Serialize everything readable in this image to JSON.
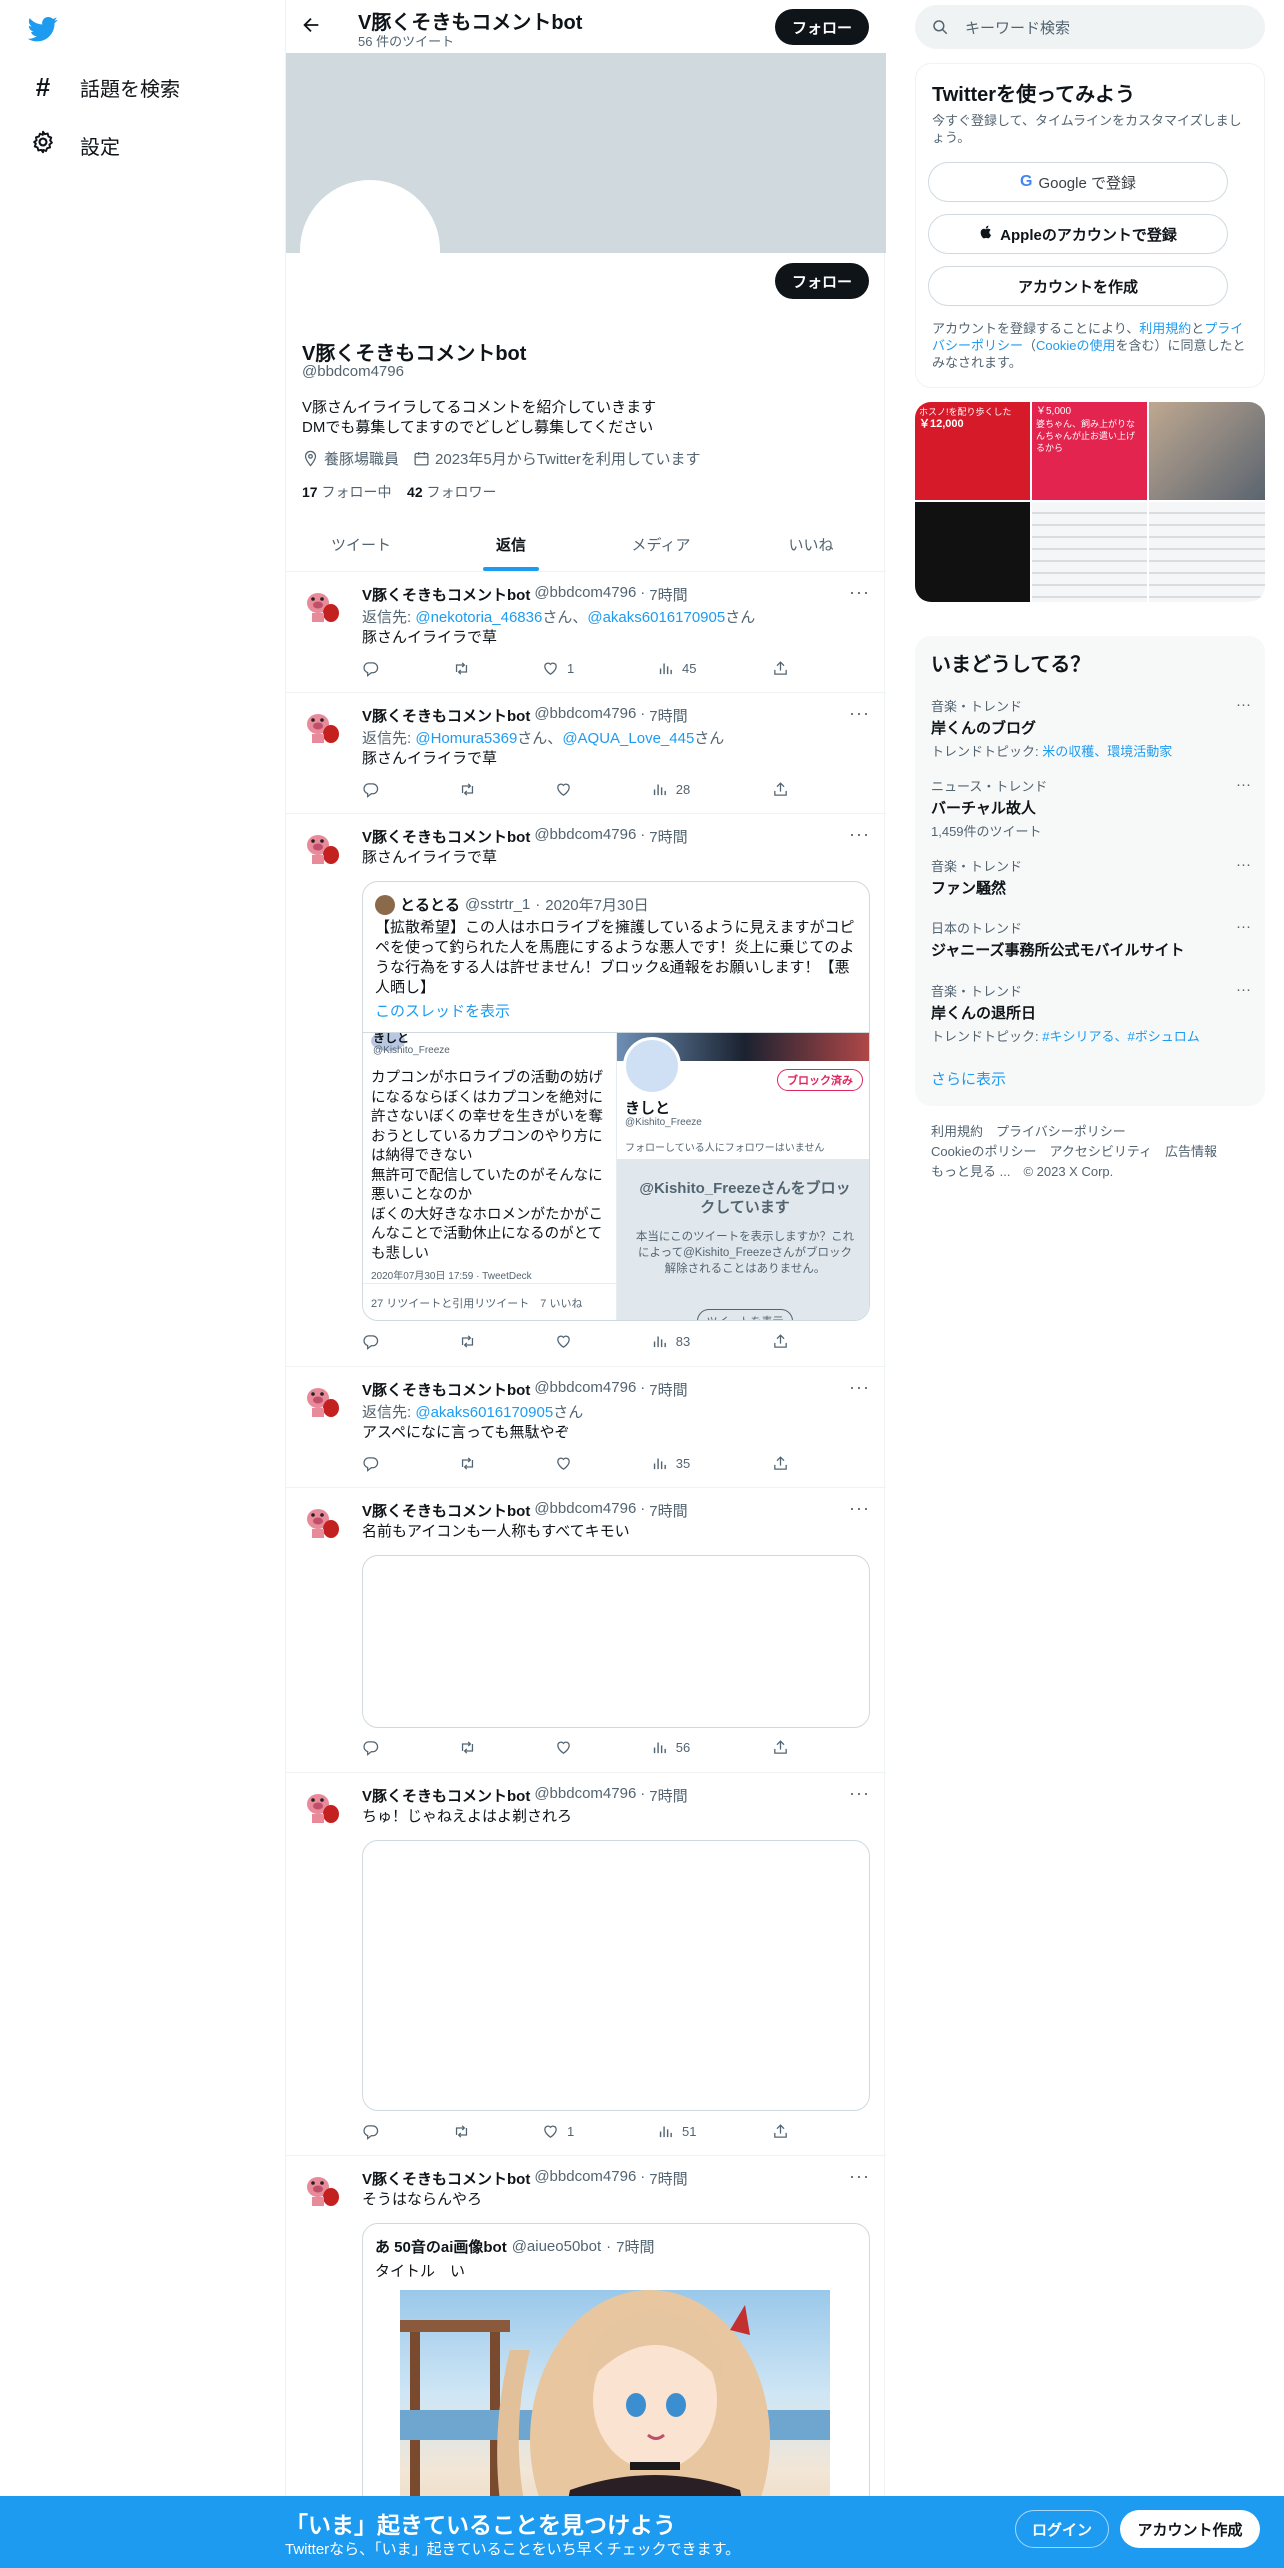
{
  "nav": {
    "explore": "話題を検索",
    "settings": "設定"
  },
  "topbar": {
    "name": "V豚くそきもコメントbot",
    "count": "56 件のツイート",
    "follow": "フォロー"
  },
  "profile": {
    "follow_button": "フォロー",
    "name": "V豚くそきもコメントbot",
    "handle": "@bbdcom4796",
    "bio_line1": "V豚さんイライラしてるコメントを紹介していきます",
    "bio_line2": "DMでも募集してますのでどしどし募集してください",
    "location": "養豚場職員",
    "joined": "2023年5月からTwitterを利用しています",
    "following_count": "17",
    "following_label": "フォロー中",
    "followers_count": "42",
    "followers_label": "フォロワー"
  },
  "tabs": [
    "ツイート",
    "返信",
    "メディア",
    "いいね"
  ],
  "tweets": [
    {
      "name": "V豚くそきもコメントbot",
      "handle": "@bbdcom4796",
      "time": "7時間",
      "reply_prefix": "返信先: ",
      "reply_to": "@nekotoria_46836",
      "reply_mid": "さん、",
      "reply_to2": "@akaks6016170905",
      "reply_suffix": "さん",
      "text": "豚さんイライラで草",
      "likes": "1",
      "views": "45"
    },
    {
      "name": "V豚くそきもコメントbot",
      "handle": "@bbdcom4796",
      "time": "7時間",
      "reply_prefix": "返信先: ",
      "reply_to": "@Homura5369",
      "reply_mid": "さん、",
      "reply_to2": "@AQUA_Love_445",
      "reply_suffix": "さん",
      "text": "豚さんイライラで草",
      "likes": "",
      "views": "28"
    },
    {
      "name": "V豚くそきもコメントbot",
      "handle": "@bbdcom4796",
      "time": "7時間",
      "text": "豚さんイライラで草",
      "views": "83",
      "quote": {
        "name": "とるとる",
        "handle": "@sstrtr_1",
        "date": "2020年7月30日",
        "text": "【拡散希望】この人はホロライブを擁護しているように見えますがコピペを使って釣られた人を馬鹿にするような悪人です！炎上に乗じてのような行為をする人は許せません！ブロック&通報をお願いします！【悪人晒し】",
        "thread": "このスレッドを表示",
        "inner_left": {
          "name": "きしと",
          "handle": "@Kishito_Freeze",
          "text": "カプコンがホロライブの活動の妨げになるならぼくはカプコンを絶対に許さないぼくの幸せを生きがいを奪おうとしているカプコンのやり方には納得できない\n無許可で配信していたのがそんなに悪いことなのか\nぼくの大好きなホロメンがたかがこんなことで活動休止になるのがとても悲しい",
          "meta": "2020年07月30日 17:59 · TweetDeck",
          "stats": "27 リツイートと引用リツイート　7 いいね"
        },
        "inner_right": {
          "name": "きしと",
          "handle": "@Kishito_Freeze",
          "blocked": "ブロック済み",
          "no_followers": "フォローしている人にフォロワーはいません",
          "block_title": "@Kishito_Freezeさんをブロックしています",
          "block_text": "本当にこのツイートを表示しますか？これによって@Kishito_Freezeさんがブロック解除されることはありません。",
          "show": "ツイートを表示"
        }
      }
    },
    {
      "name": "V豚くそきもコメントbot",
      "handle": "@bbdcom4796",
      "time": "7時間",
      "reply_prefix": "返信先: ",
      "reply_to": "@akaks6016170905",
      "reply_suffix": "さん",
      "text": "アスペになに言っても無駄やぞ",
      "views": "35"
    },
    {
      "name": "V豚くそきもコメントbot",
      "handle": "@bbdcom4796",
      "time": "7時間",
      "text": "名前もアイコンも一人称もすべてキモい",
      "views": "56"
    },
    {
      "name": "V豚くそきもコメントbot",
      "handle": "@bbdcom4796",
      "time": "7時間",
      "text": "ちゅ！じゃねえよはよ剃されろ",
      "likes": "1",
      "views": "51"
    },
    {
      "name": "V豚くそきもコメントbot",
      "handle": "@bbdcom4796",
      "time": "7時間",
      "text": "そうはならんやろ",
      "quote": {
        "name": "あ 50音のai画像bot",
        "handle": "@aiueo50bot",
        "time": "7時間",
        "text": "タイトル　い"
      }
    }
  ],
  "search": {
    "placeholder": "キーワード検索"
  },
  "signup": {
    "title": "Twitterを使ってみよう",
    "subtitle": "今すぐ登録して、タイムラインをカスタマイズしましょう。",
    "google": "Google で登録",
    "apple": "Appleのアカウントで登録",
    "create": "アカウントを作成",
    "terms_1": "アカウントを登録することにより、",
    "terms_link1": "利用規約",
    "terms_2": "と",
    "terms_link2": "プライバシーポリシー",
    "terms_3": "（",
    "terms_link3": "Cookieの使用",
    "terms_4": "を含む）に同意したとみなされます。"
  },
  "media_grid": {
    "cell1_price": "￥12,000",
    "cell1_text": "ホスノ!を配り歩くした",
    "cell2_price": "￥5,000",
    "cell2_text": "婆ちゃん、飼み上がりなんちゃんが止お遣い上げるから"
  },
  "trends": {
    "title": "いまどうしてる？",
    "items": [
      {
        "category": "音楽・トレンド",
        "title": "岸くんのブログ",
        "sub_prefix": "トレンドトピック: ",
        "sub_link": "米の収穫、環境活動家"
      },
      {
        "category": "ニュース・トレンド",
        "title": "バーチャル故人",
        "sub_prefix": "1,459件のツイート",
        "sub_link": ""
      },
      {
        "category": "音楽・トレンド",
        "title": "ファン騒然",
        "sub_prefix": "",
        "sub_link": ""
      },
      {
        "category": "日本のトレンド",
        "title": "ジャニーズ事務所公式モバイルサイト",
        "sub_prefix": "",
        "sub_link": ""
      },
      {
        "category": "音楽・トレンド",
        "title": "岸くんの退所日",
        "sub_prefix": "トレンドトピック: ",
        "sub_link": "#キシリアる、#ボシュロム"
      }
    ],
    "more": "さらに表示"
  },
  "footer": {
    "line1": "利用規約　プライバシーポリシー",
    "line2": "Cookieのポリシー　アクセシビリティ　広告情報",
    "line3": "もっと見る ...　© 2023 X Corp."
  },
  "bottom": {
    "title": "「いま」起きていることを見つけよう",
    "subtitle": "Twitterなら、「いま」起きていることをいち早くチェックできます。",
    "login": "ログイン",
    "signup": "アカウント作成"
  },
  "colors": {
    "accent": "#1d9bf0",
    "dark": "#0f1419",
    "muted": "#536471",
    "banner": "#cfd9de"
  }
}
